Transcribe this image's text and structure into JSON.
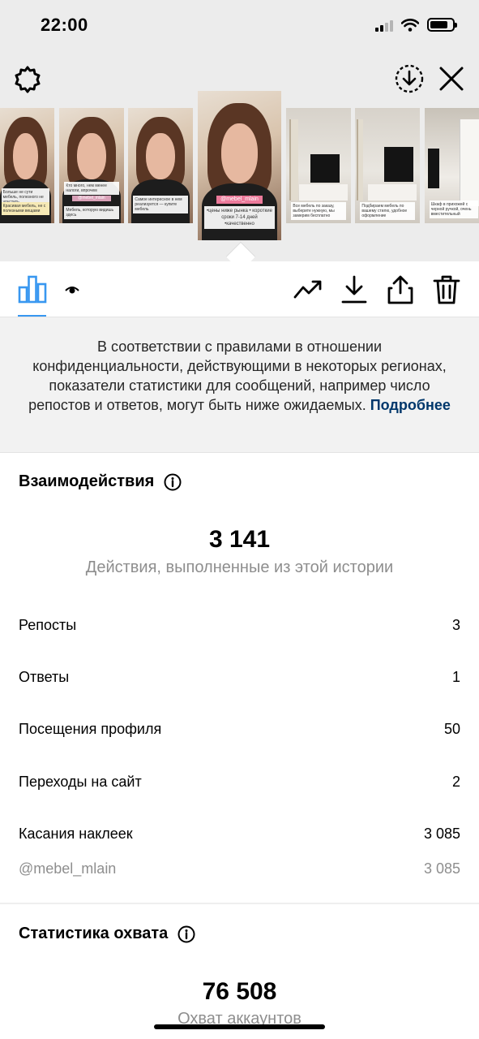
{
  "status_bar": {
    "time": "22:00"
  },
  "thumbnails": [
    {
      "kind": "person",
      "caption": "Больше не сути мебель, полезного не упустить",
      "caption2": "Красивая мебель, не с полезными вещами"
    },
    {
      "kind": "person",
      "caption": "Кто много, нем менее налоги, впрочем",
      "tag": "@mebel_mlain",
      "caption2": "Мебель, которую видишь здесь"
    },
    {
      "kind": "person",
      "caption": "Самое интересное в нем реализуется — купите мебель",
      "caption2": ""
    },
    {
      "kind": "person",
      "active": true,
      "tag": "@mebel_mlain",
      "caption": "•цены ниже рынка • короткие сроки 7-14 дней •качественно"
    },
    {
      "kind": "room",
      "caption": "Все мебель по заказу, выберите нужную, мы замерим бесплатно"
    },
    {
      "kind": "room",
      "caption": "Подбираем мебель по вашему стилю, удобное оформление"
    },
    {
      "kind": "room",
      "caption": "Шкаф в прихожей с черной ручкой, очень вместительный"
    }
  ],
  "notice": {
    "text": "В соответствии с правилами в отношении конфиденциальности, действующими в некоторых регионах, показатели статистики для сообщений, например число репостов и ответов, могут быть ниже ожидаемых.",
    "link": "Подробнее"
  },
  "interactions": {
    "title": "Взаимодействия",
    "total": "3 141",
    "total_label": "Действия, выполненные из этой истории",
    "rows": [
      {
        "label": "Репосты",
        "value": "3"
      },
      {
        "label": "Ответы",
        "value": "1"
      },
      {
        "label": "Посещения профиля",
        "value": "50"
      },
      {
        "label": "Переходы на сайт",
        "value": "2"
      },
      {
        "label": "Касания наклеек",
        "value": "3 085"
      }
    ],
    "sub_row": {
      "label": "@mebel_mlain",
      "value": "3 085"
    }
  },
  "reach": {
    "title": "Статистика охвата",
    "total": "76 508",
    "total_label": "Охват аккаунтов"
  },
  "colors": {
    "accent": "#3897f0",
    "link": "#00376b",
    "muted": "#8e8e8e"
  }
}
